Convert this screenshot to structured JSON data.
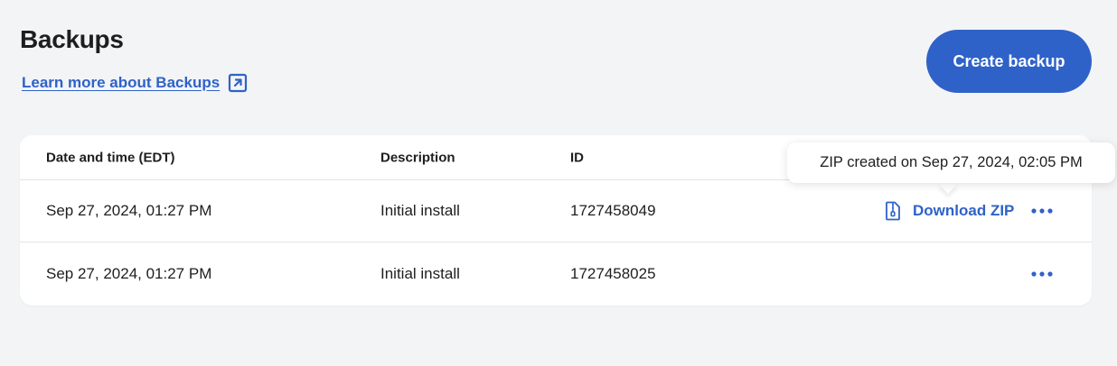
{
  "header": {
    "title": "Backups",
    "learn_more_label": "Learn more about Backups",
    "create_button_label": "Create backup"
  },
  "table": {
    "columns": [
      "Date and time (EDT)",
      "Description",
      "ID"
    ],
    "rows": [
      {
        "date": "Sep 27, 2024, 01:27 PM",
        "description": "Initial install",
        "id": "1727458049",
        "download_label": "Download ZIP"
      },
      {
        "date": "Sep 27, 2024, 01:27 PM",
        "description": "Initial install",
        "id": "1727458025"
      }
    ]
  },
  "tooltip": {
    "text": "ZIP created on Sep 27, 2024, 02:05 PM"
  },
  "colors": {
    "accent": "#2f62c8",
    "background": "#f3f4f6",
    "card": "#ffffff"
  }
}
